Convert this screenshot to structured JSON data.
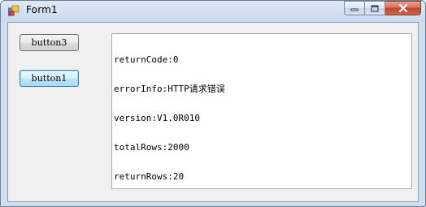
{
  "window": {
    "title": "Form1",
    "buttons": {
      "minimize": "▭",
      "maximize": "□",
      "close": "✕"
    }
  },
  "form": {
    "button3_label": "button3",
    "button1_label": "button1",
    "output_lines": [
      "returnCode:0",
      "errorInfo:HTTP请求错误",
      "version:V1.0R010",
      "totalRows:2000",
      "returnRows:20"
    ]
  },
  "colors": {
    "focus_border": "#3c7fb1",
    "close_button": "#c1442b"
  }
}
